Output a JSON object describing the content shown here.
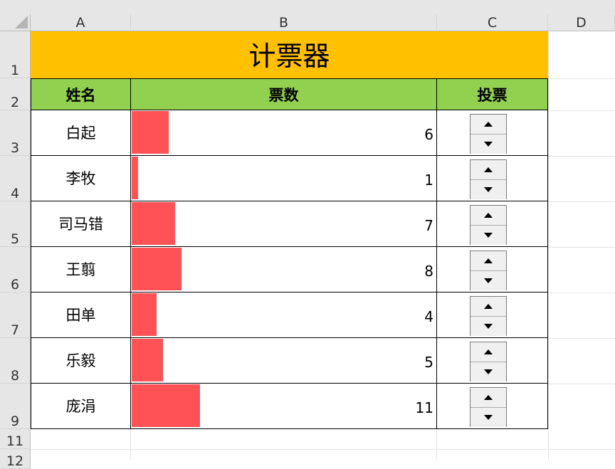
{
  "columns": [
    "A",
    "B",
    "C",
    "D"
  ],
  "row_numbers": [
    "1",
    "2",
    "3",
    "4",
    "5",
    "6",
    "7",
    "8",
    "9",
    "11",
    "12"
  ],
  "title": "计票器",
  "headers": {
    "name": "姓名",
    "votes": "票数",
    "vote": "投票"
  },
  "max_votes": 11,
  "rows": [
    {
      "name": "白起",
      "votes": 6
    },
    {
      "name": "李牧",
      "votes": 1
    },
    {
      "name": "司马错",
      "votes": 7
    },
    {
      "name": "王翦",
      "votes": 8
    },
    {
      "name": "田单",
      "votes": 4
    },
    {
      "name": "乐毅",
      "votes": 5
    },
    {
      "name": "庞涓",
      "votes": 11
    }
  ],
  "colors": {
    "title_bg": "#ffc000",
    "header_bg": "#92d050",
    "bar": "#ff5257"
  }
}
